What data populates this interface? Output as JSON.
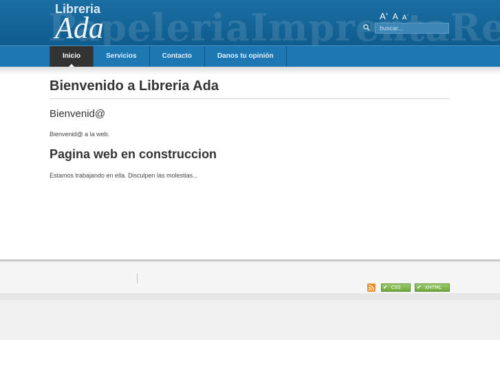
{
  "header": {
    "logo_top": "Libreria",
    "logo_main": "Ada",
    "watermark": "PapeleriaImprentaRegalo",
    "font_size_controls": {
      "increase": "A",
      "normal": "A",
      "decrease": "A"
    },
    "search": {
      "placeholder": "buscar..."
    }
  },
  "nav": {
    "items": [
      {
        "label": "Inicio",
        "active": true
      },
      {
        "label": "Servicios"
      },
      {
        "label": "Contacto"
      },
      {
        "label": "Danos tu opinión"
      }
    ]
  },
  "content": {
    "title": "Bienvenido a Libreria Ada",
    "heading1": "Bienvenid@",
    "paragraph1": "Bienvenid@ a la web.",
    "heading2": "Pagina web en construccion",
    "paragraph2": "Estamos trabajando en ella. Disculpen las molestias..."
  },
  "footer": {
    "css_badge": "CSS",
    "xhtml_badge": "XHTML",
    "rss_icon": "rss-icon"
  },
  "colors": {
    "header_blue": "#1b6ea3",
    "nav_blue": "#1c77b2",
    "active_tab": "#333333",
    "badge_green": "#7fb64a",
    "rss_orange": "#f08a24"
  }
}
